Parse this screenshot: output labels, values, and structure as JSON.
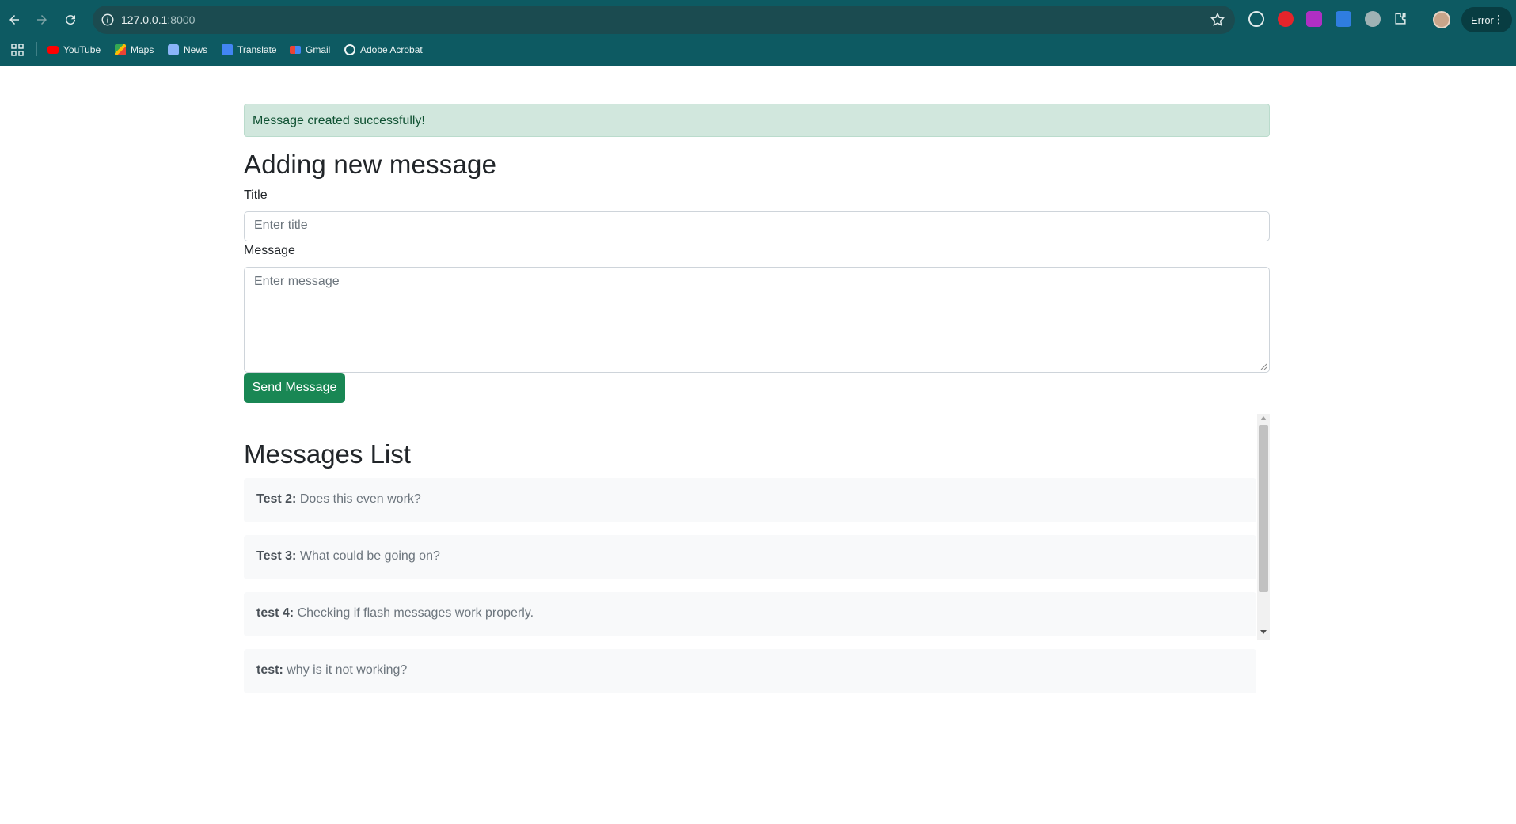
{
  "browser": {
    "url_host": "127.0.0.1",
    "url_port": ":8000",
    "error_label": "Error",
    "bookmarks": [
      {
        "label": "YouTube",
        "icon": "youtube-icon"
      },
      {
        "label": "Maps",
        "icon": "maps-icon"
      },
      {
        "label": "News",
        "icon": "news-icon"
      },
      {
        "label": "Translate",
        "icon": "translate-icon"
      },
      {
        "label": "Gmail",
        "icon": "gmail-icon"
      },
      {
        "label": "Adobe Acrobat",
        "icon": "adobe-acrobat-icon"
      }
    ],
    "colors": {
      "chrome": "#0d5a62",
      "omnibox": "#1b4b50"
    }
  },
  "alert": {
    "text": "Message created successfully!"
  },
  "form": {
    "title": "Adding new message",
    "title_label": "Title",
    "title_placeholder": "Enter title",
    "message_label": "Message",
    "message_placeholder": "Enter message",
    "submit_label": "Send Message",
    "submit_color": "#198754"
  },
  "messages": {
    "heading": "Messages List",
    "items": [
      {
        "title": "Test 2:",
        "body": "Does this even work?"
      },
      {
        "title": "Test 3:",
        "body": "What could be going on?"
      },
      {
        "title": "test 4:",
        "body": "Checking if flash messages work properly."
      },
      {
        "title": "test:",
        "body": "why is it not working?"
      }
    ]
  }
}
